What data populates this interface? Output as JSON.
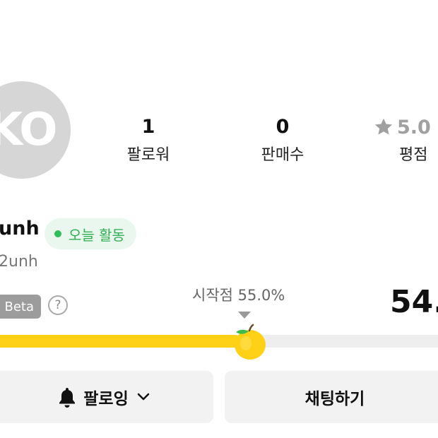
{
  "profile": {
    "avatar_text": "KO",
    "username": "unh",
    "handle": "2unh",
    "activity_badge": "오늘 활동",
    "activity_color": "#2fbf5a"
  },
  "stats": {
    "followers": {
      "value": "1",
      "label": "팔로워"
    },
    "sales": {
      "value": "0",
      "label": "판매수"
    },
    "rating": {
      "value": "5.0",
      "label": "평점",
      "icon": "star-icon"
    }
  },
  "meter": {
    "beta_label": "Beta",
    "help_symbol": "?",
    "start_label": "시작점 55.0%",
    "start_fraction": 0.55,
    "score_text": "54.",
    "fill_fraction": 0.548,
    "fill_color": "#ffd116",
    "track_color": "#eeeeee",
    "icon": "apple-icon"
  },
  "actions": {
    "follow_label": "팔로잉",
    "follow_icon": "bell-icon",
    "follow_dropdown_icon": "chevron-down-icon",
    "chat_label": "채팅하기"
  }
}
